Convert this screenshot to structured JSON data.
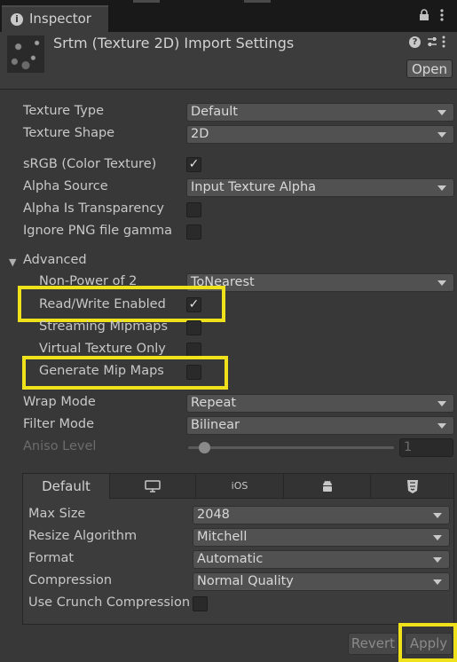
{
  "window": {
    "tab_title": "Inspector",
    "header_title": "Srtm (Texture 2D) Import Settings",
    "open_label": "Open"
  },
  "icons": [
    "info-icon",
    "lock-icon",
    "kebab-menu-icon",
    "help-icon",
    "preset-icon",
    "settings-icon"
  ],
  "settings": {
    "texture_type": {
      "label": "Texture Type",
      "value": "Default"
    },
    "texture_shape": {
      "label": "Texture Shape",
      "value": "2D"
    },
    "srgb": {
      "label": "sRGB (Color Texture)",
      "checked": true
    },
    "alpha_source": {
      "label": "Alpha Source",
      "value": "Input Texture Alpha"
    },
    "alpha_is_transparency": {
      "label": "Alpha Is Transparency",
      "checked": false
    },
    "ignore_png_gamma": {
      "label": "Ignore PNG file gamma",
      "checked": false
    },
    "advanced": {
      "label": "Advanced",
      "expanded": true
    },
    "non_power_of_2": {
      "label": "Non-Power of 2",
      "value": "ToNearest"
    },
    "read_write_enabled": {
      "label": "Read/Write Enabled",
      "checked": true
    },
    "streaming_mipmaps": {
      "label": "Streaming Mipmaps",
      "checked": false
    },
    "virtual_texture_only": {
      "label": "Virtual Texture Only",
      "checked": false
    },
    "generate_mip_maps": {
      "label": "Generate Mip Maps",
      "checked": false
    },
    "wrap_mode": {
      "label": "Wrap Mode",
      "value": "Repeat"
    },
    "filter_mode": {
      "label": "Filter Mode",
      "value": "Bilinear"
    },
    "aniso_level": {
      "label": "Aniso Level",
      "value": "1",
      "level": 1
    }
  },
  "platform": {
    "tabs": [
      {
        "label": "Default",
        "icon": "default-tab"
      },
      {
        "label": "",
        "icon": "monitor-icon"
      },
      {
        "label": "iOS",
        "icon": "ios-icon"
      },
      {
        "label": "",
        "icon": "android-icon"
      },
      {
        "label": "",
        "icon": "html5-icon"
      }
    ],
    "max_size": {
      "label": "Max Size",
      "value": "2048"
    },
    "resize_algorithm": {
      "label": "Resize Algorithm",
      "value": "Mitchell"
    },
    "format": {
      "label": "Format",
      "value": "Automatic"
    },
    "compression": {
      "label": "Compression",
      "value": "Normal Quality"
    },
    "use_crunch": {
      "label": "Use Crunch Compression",
      "checked": false
    }
  },
  "footer": {
    "revert_label": "Revert",
    "apply_label": "Apply"
  },
  "colors": {
    "highlight": "#f0e21a",
    "background": "#383838",
    "header": "#3c3c3c"
  }
}
